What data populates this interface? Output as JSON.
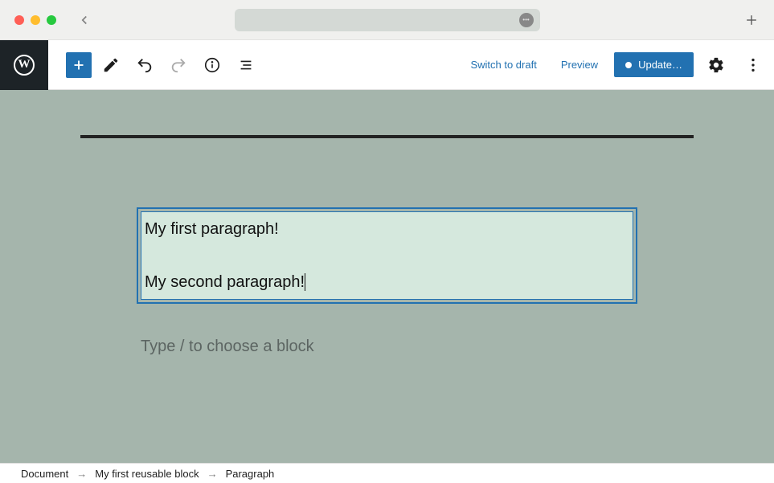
{
  "chrome": {},
  "toolbar": {
    "wp_logo_text": "W",
    "switch_draft_label": "Switch to draft",
    "preview_label": "Preview",
    "update_label": "Update…"
  },
  "editor": {
    "paragraph1": "My first paragraph!",
    "paragraph2": "My second paragraph!",
    "placeholder": "Type / to choose a block"
  },
  "breadcrumb": {
    "item1": "Document",
    "item2": "My first reusable block",
    "item3": "Paragraph",
    "sep": "→"
  }
}
